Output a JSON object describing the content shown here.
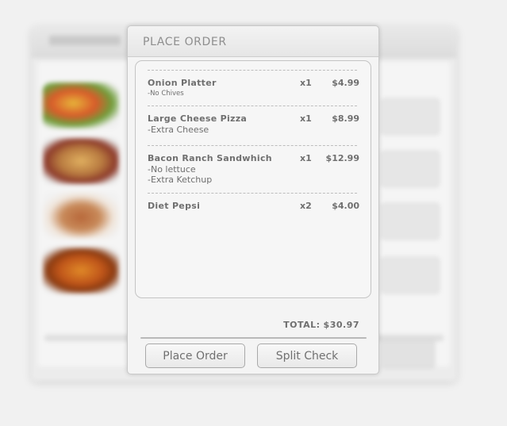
{
  "dialog": {
    "title": "PLACE ORDER",
    "items": [
      {
        "name": "Onion Platter",
        "qty": "x1",
        "price": "$4.99",
        "mods": [
          "-No Chives"
        ]
      },
      {
        "name": "Large Cheese Pizza",
        "qty": "x1",
        "price": "$8.99",
        "mods": [
          "-Extra Cheese"
        ]
      },
      {
        "name": "Bacon Ranch Sandwhich",
        "qty": "x1",
        "price": "$12.99",
        "mods": [
          "-No lettuce",
          "-Extra Ketchup"
        ]
      },
      {
        "name": "Diet Pepsi",
        "qty": "x2",
        "price": "$4.00",
        "mods": []
      }
    ],
    "total_label": "TOTAL:",
    "total_value": "$30.97",
    "buttons": {
      "place_order": "Place Order",
      "split_check": "Split Check"
    }
  }
}
